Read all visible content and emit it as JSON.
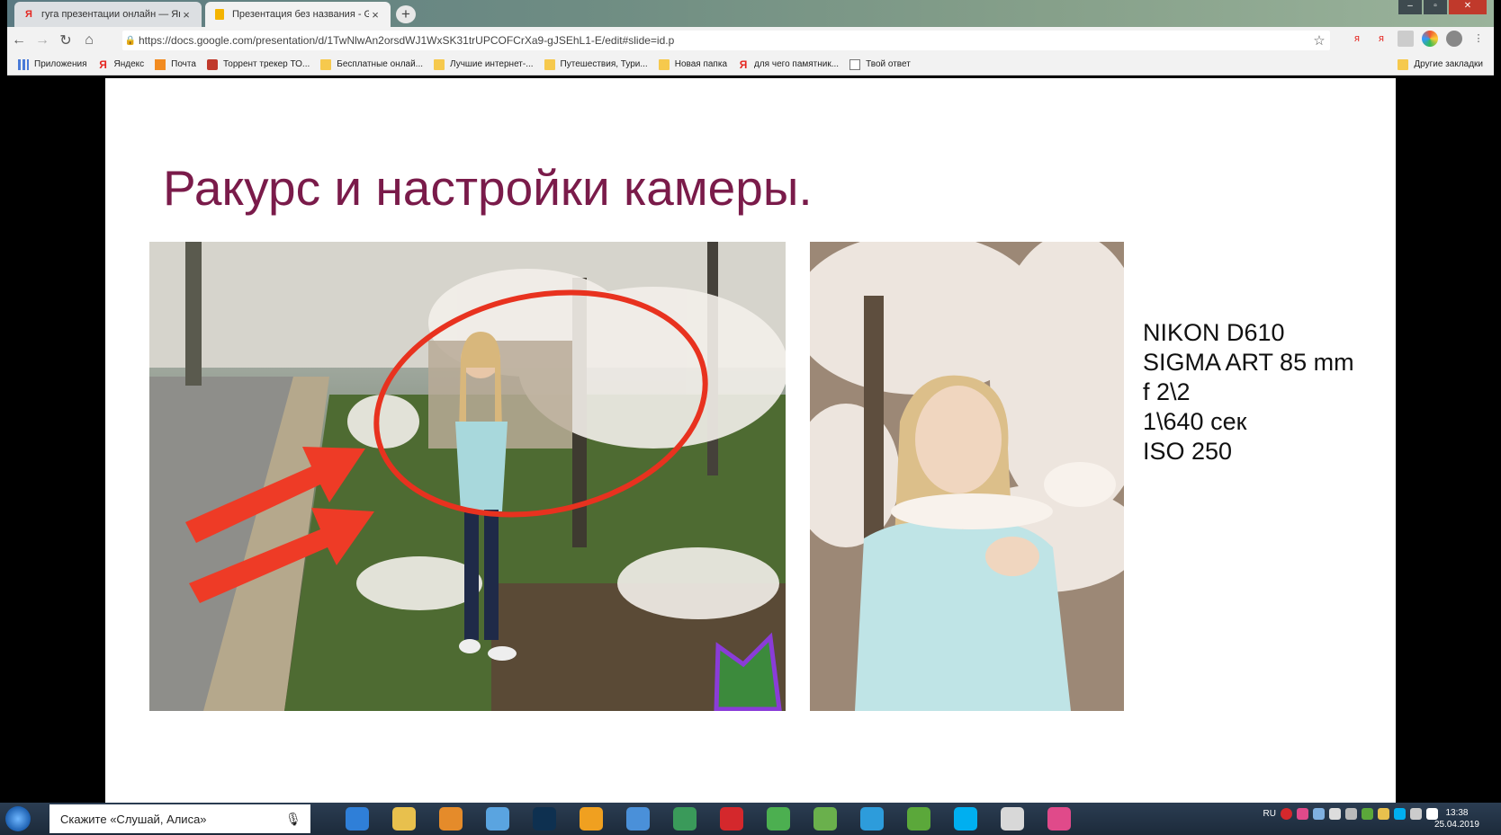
{
  "browser": {
    "tabs": [
      {
        "label": "гуга презентации онлайн — Ян",
        "close": "×"
      },
      {
        "label": "Презентация без названия - Go",
        "close": "×"
      }
    ],
    "new_tab": "+",
    "url": "https://docs.google.com/presentation/d/1TwNlwAn2orsdWJ1WxSK31trUPCOFCrXa9-gJSEhL1-E/edit#slide=id.p",
    "bookmarks": [
      {
        "label": "Приложения",
        "icon": "apps-icon"
      },
      {
        "label": "Яндекс",
        "icon": "yandex-icon"
      },
      {
        "label": "Почта",
        "icon": "mail-icon"
      },
      {
        "label": "Торрент трекер ТО...",
        "icon": "torrent-icon"
      },
      {
        "label": "Бесплатные онлай...",
        "icon": "folder-icon"
      },
      {
        "label": "Лучшие интернет-...",
        "icon": "folder-icon"
      },
      {
        "label": "Путешествия, Тури...",
        "icon": "folder-icon"
      },
      {
        "label": "Новая папка",
        "icon": "folder-icon"
      },
      {
        "label": "для чего памятник...",
        "icon": "yandex-icon"
      },
      {
        "label": "Твой ответ",
        "icon": "page-icon"
      }
    ],
    "other_bookmarks": "Другие закладки"
  },
  "slide": {
    "title": "Ракурс и настройки камеры.",
    "specs": [
      "NIKON D610",
      "SIGMA ART 85 mm",
      "f 2\\2",
      "1\\640 сек",
      "ISO 250"
    ]
  },
  "taskbar": {
    "search_placeholder": "Скажите «Слушай, Алиса»",
    "language": "RU",
    "time": "13:38",
    "date": "25.04.2019",
    "apps": [
      {
        "name": "ie-icon",
        "color": "#2f7fd8"
      },
      {
        "name": "explorer-icon",
        "color": "#e8c04d"
      },
      {
        "name": "media-player-icon",
        "color": "#e58b2a"
      },
      {
        "name": "audio-icon",
        "color": "#5aa4e0"
      },
      {
        "name": "photoshop-icon",
        "color": "#0e3050"
      },
      {
        "name": "aimp-icon",
        "color": "#f0a020"
      },
      {
        "name": "mail-app-icon",
        "color": "#4a90d9"
      },
      {
        "name": "vpn-icon",
        "color": "#3a9a5a"
      },
      {
        "name": "opera-icon",
        "color": "#d4282c"
      },
      {
        "name": "chrome-icon",
        "color": "#4caf50"
      },
      {
        "name": "wifi-app-icon",
        "color": "#6ab04c"
      },
      {
        "name": "skype-alt-icon",
        "color": "#2d9cdb"
      },
      {
        "name": "utorrent-icon",
        "color": "#5ba83a"
      },
      {
        "name": "skype-icon",
        "color": "#00aff0"
      },
      {
        "name": "camera-app-icon",
        "color": "#d8d8d8"
      },
      {
        "name": "photo-app-icon",
        "color": "#e04a8a"
      }
    ]
  }
}
